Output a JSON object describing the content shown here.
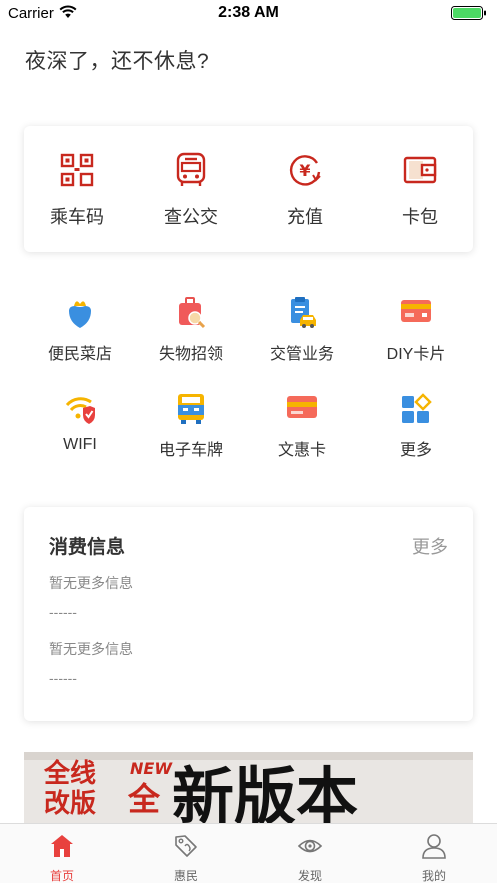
{
  "status_bar": {
    "carrier": "Carrier",
    "time": "2:38 AM"
  },
  "greeting": "夜深了，还不休息?",
  "main_actions": [
    {
      "label": "乘车码",
      "icon": "qr-code-icon"
    },
    {
      "label": "查公交",
      "icon": "bus-icon"
    },
    {
      "label": "充值",
      "icon": "yen-recharge-icon"
    },
    {
      "label": "卡包",
      "icon": "wallet-icon"
    }
  ],
  "services": [
    {
      "label": "便民菜店",
      "icon": "vegetable-shop-icon"
    },
    {
      "label": "失物招领",
      "icon": "lost-found-icon"
    },
    {
      "label": "交管业务",
      "icon": "traffic-management-icon"
    },
    {
      "label": "DIY卡片",
      "icon": "diy-card-icon"
    },
    {
      "label": "WIFI",
      "icon": "wifi-shield-icon"
    },
    {
      "label": "电子车牌",
      "icon": "electronic-plate-icon"
    },
    {
      "label": "文惠卡",
      "icon": "culture-card-icon"
    },
    {
      "label": "更多",
      "icon": "more-grid-icon"
    }
  ],
  "consumption": {
    "title": "消费信息",
    "more": "更多",
    "entries": [
      {
        "text": "暂无更多信息",
        "value": "------"
      },
      {
        "text": "暂无更多信息",
        "value": "------"
      }
    ]
  },
  "banner": {
    "text": "全线改版 NEW 全新版本"
  },
  "tabbar": [
    {
      "label": "首页",
      "icon": "home-icon",
      "active": true
    },
    {
      "label": "惠民",
      "icon": "tag-icon",
      "active": false
    },
    {
      "label": "发现",
      "icon": "eye-icon",
      "active": false
    },
    {
      "label": "我的",
      "icon": "user-icon",
      "active": false
    }
  ],
  "colors": {
    "accent": "#e8413e",
    "brand_red": "#c8281e",
    "text": "#333333"
  }
}
